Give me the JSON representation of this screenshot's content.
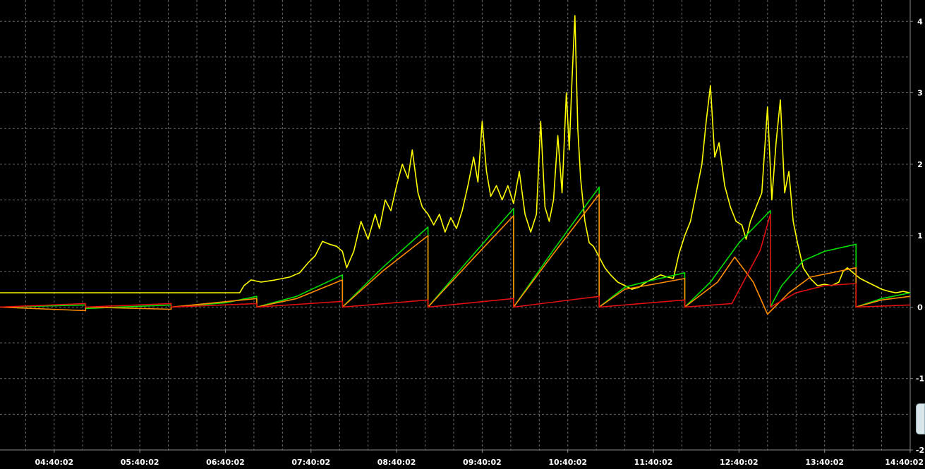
{
  "chart_data": {
    "type": "line",
    "title": "",
    "xlabel": "",
    "ylabel": "",
    "ylim": [
      -2,
      4.2
    ],
    "yticks": [
      "-2",
      "-1",
      "0",
      "1",
      "2",
      "3",
      "4"
    ],
    "xticks": [
      "04:40:02",
      "05:40:02",
      "06:40:02",
      "07:40:02",
      "08:40:02",
      "09:40:02",
      "10:40:02",
      "11:40:02",
      "12:40:02",
      "13:40:02",
      "14:40:02"
    ],
    "xlim": [
      "04:02",
      "14:40"
    ],
    "grid": true,
    "background": "#000000",
    "series": [
      {
        "color": "#ffff00",
        "points": [
          [
            "04:02",
            0.2
          ],
          [
            "05:00",
            0.2
          ],
          [
            "06:00",
            0.2
          ],
          [
            "06:50",
            0.2
          ],
          [
            "06:53",
            0.3
          ],
          [
            "06:58",
            0.38
          ],
          [
            "07:05",
            0.35
          ],
          [
            "07:15",
            0.38
          ],
          [
            "07:25",
            0.42
          ],
          [
            "07:32",
            0.48
          ],
          [
            "07:38",
            0.62
          ],
          [
            "07:43",
            0.72
          ],
          [
            "07:48",
            0.92
          ],
          [
            "07:53",
            0.88
          ],
          [
            "07:58",
            0.85
          ],
          [
            "08:02",
            0.78
          ],
          [
            "08:05",
            0.55
          ],
          [
            "08:10",
            0.78
          ],
          [
            "08:15",
            1.2
          ],
          [
            "08:20",
            0.95
          ],
          [
            "08:25",
            1.3
          ],
          [
            "08:28",
            1.1
          ],
          [
            "08:32",
            1.5
          ],
          [
            "08:36",
            1.35
          ],
          [
            "08:40",
            1.7
          ],
          [
            "08:44",
            2.0
          ],
          [
            "08:48",
            1.8
          ],
          [
            "08:51",
            2.2
          ],
          [
            "08:55",
            1.6
          ],
          [
            "08:58",
            1.4
          ],
          [
            "09:02",
            1.3
          ],
          [
            "09:06",
            1.15
          ],
          [
            "09:10",
            1.3
          ],
          [
            "09:14",
            1.05
          ],
          [
            "09:18",
            1.25
          ],
          [
            "09:22",
            1.1
          ],
          [
            "09:26",
            1.35
          ],
          [
            "09:30",
            1.7
          ],
          [
            "09:34",
            2.1
          ],
          [
            "09:37",
            1.75
          ],
          [
            "09:40",
            2.6
          ],
          [
            "09:43",
            1.9
          ],
          [
            "09:46",
            1.55
          ],
          [
            "09:50",
            1.7
          ],
          [
            "09:54",
            1.5
          ],
          [
            "09:58",
            1.7
          ],
          [
            "10:02",
            1.45
          ],
          [
            "10:06",
            1.9
          ],
          [
            "10:10",
            1.3
          ],
          [
            "10:14",
            1.05
          ],
          [
            "10:18",
            1.3
          ],
          [
            "10:21",
            2.6
          ],
          [
            "10:24",
            1.4
          ],
          [
            "10:27",
            1.2
          ],
          [
            "10:30",
            1.5
          ],
          [
            "10:33",
            2.4
          ],
          [
            "10:36",
            1.6
          ],
          [
            "10:39",
            3.0
          ],
          [
            "10:41",
            2.2
          ],
          [
            "10:43",
            3.2
          ],
          [
            "10:45",
            4.08
          ],
          [
            "10:47",
            2.5
          ],
          [
            "10:49",
            1.8
          ],
          [
            "10:52",
            1.2
          ],
          [
            "10:55",
            0.9
          ],
          [
            "10:58",
            0.85
          ],
          [
            "11:02",
            0.7
          ],
          [
            "11:06",
            0.55
          ],
          [
            "11:10",
            0.45
          ],
          [
            "11:15",
            0.35
          ],
          [
            "11:20",
            0.3
          ],
          [
            "11:25",
            0.25
          ],
          [
            "11:30",
            0.28
          ],
          [
            "11:35",
            0.35
          ],
          [
            "11:40",
            0.4
          ],
          [
            "11:45",
            0.45
          ],
          [
            "11:50",
            0.42
          ],
          [
            "11:54",
            0.4
          ],
          [
            "11:58",
            0.75
          ],
          [
            "12:02",
            1.0
          ],
          [
            "12:06",
            1.2
          ],
          [
            "12:10",
            1.6
          ],
          [
            "12:14",
            2.0
          ],
          [
            "12:17",
            2.6
          ],
          [
            "12:20",
            3.1
          ],
          [
            "12:23",
            2.1
          ],
          [
            "12:26",
            2.3
          ],
          [
            "12:30",
            1.7
          ],
          [
            "12:34",
            1.4
          ],
          [
            "12:38",
            1.2
          ],
          [
            "12:42",
            1.15
          ],
          [
            "12:45",
            0.95
          ],
          [
            "12:48",
            1.2
          ],
          [
            "12:52",
            1.4
          ],
          [
            "12:56",
            1.6
          ],
          [
            "13:00",
            2.8
          ],
          [
            "13:03",
            1.5
          ],
          [
            "13:06",
            2.3
          ],
          [
            "13:09",
            2.9
          ],
          [
            "13:12",
            1.6
          ],
          [
            "13:15",
            1.9
          ],
          [
            "13:18",
            1.2
          ],
          [
            "13:21",
            0.9
          ],
          [
            "13:25",
            0.55
          ],
          [
            "13:30",
            0.4
          ],
          [
            "13:35",
            0.3
          ],
          [
            "13:40",
            0.32
          ],
          [
            "13:45",
            0.3
          ],
          [
            "13:50",
            0.35
          ],
          [
            "13:53",
            0.5
          ],
          [
            "13:56",
            0.55
          ],
          [
            "14:00",
            0.48
          ],
          [
            "14:05",
            0.4
          ],
          [
            "14:10",
            0.35
          ],
          [
            "14:15",
            0.3
          ],
          [
            "14:20",
            0.25
          ],
          [
            "14:25",
            0.22
          ],
          [
            "14:30",
            0.2
          ],
          [
            "14:35",
            0.22
          ],
          [
            "14:40",
            0.2
          ]
        ]
      },
      {
        "color": "#00e000",
        "points": [
          [
            "04:02",
            0.0
          ],
          [
            "05:02",
            0.03
          ],
          [
            "05:02",
            -0.02
          ],
          [
            "06:02",
            0.03
          ],
          [
            "06:02",
            0.0
          ],
          [
            "06:40",
            0.06
          ],
          [
            "07:02",
            0.15
          ],
          [
            "07:02",
            0.0
          ],
          [
            "07:30",
            0.15
          ],
          [
            "08:02",
            0.45
          ],
          [
            "08:02",
            0.0
          ],
          [
            "08:30",
            0.55
          ],
          [
            "09:02",
            1.12
          ],
          [
            "09:02",
            0.0
          ],
          [
            "09:30",
            0.65
          ],
          [
            "10:02",
            1.38
          ],
          [
            "10:02",
            0.0
          ],
          [
            "10:30",
            0.8
          ],
          [
            "11:02",
            1.68
          ],
          [
            "11:02",
            0.0
          ],
          [
            "11:20",
            0.28
          ],
          [
            "11:40",
            0.38
          ],
          [
            "12:02",
            0.48
          ],
          [
            "12:02",
            0.0
          ],
          [
            "12:20",
            0.35
          ],
          [
            "12:40",
            0.9
          ],
          [
            "13:02",
            1.35
          ],
          [
            "13:02",
            0.0
          ],
          [
            "13:10",
            0.3
          ],
          [
            "13:25",
            0.65
          ],
          [
            "13:40",
            0.78
          ],
          [
            "14:02",
            0.88
          ],
          [
            "14:02",
            0.0
          ],
          [
            "14:20",
            0.12
          ],
          [
            "14:40",
            0.2
          ]
        ]
      },
      {
        "color": "#ff8c00",
        "points": [
          [
            "04:02",
            0.0
          ],
          [
            "05:02",
            -0.05
          ],
          [
            "05:02",
            0.0
          ],
          [
            "06:02",
            -0.03
          ],
          [
            "06:02",
            0.0
          ],
          [
            "07:02",
            0.12
          ],
          [
            "07:02",
            0.0
          ],
          [
            "07:30",
            0.12
          ],
          [
            "08:02",
            0.38
          ],
          [
            "08:02",
            0.0
          ],
          [
            "08:30",
            0.5
          ],
          [
            "09:02",
            1.0
          ],
          [
            "09:02",
            0.0
          ],
          [
            "09:30",
            0.6
          ],
          [
            "10:02",
            1.28
          ],
          [
            "10:02",
            0.0
          ],
          [
            "10:30",
            0.75
          ],
          [
            "11:02",
            1.58
          ],
          [
            "11:02",
            0.0
          ],
          [
            "11:20",
            0.25
          ],
          [
            "11:40",
            0.32
          ],
          [
            "12:02",
            0.4
          ],
          [
            "12:02",
            0.0
          ],
          [
            "12:25",
            0.35
          ],
          [
            "12:37",
            0.7
          ],
          [
            "12:50",
            0.35
          ],
          [
            "13:00",
            -0.1
          ],
          [
            "13:15",
            0.2
          ],
          [
            "13:30",
            0.42
          ],
          [
            "14:02",
            0.55
          ],
          [
            "14:02",
            0.0
          ],
          [
            "14:20",
            0.1
          ],
          [
            "14:40",
            0.15
          ]
        ]
      },
      {
        "color": "#e01010",
        "points": [
          [
            "04:02",
            0.0
          ],
          [
            "05:02",
            0.05
          ],
          [
            "05:02",
            0.0
          ],
          [
            "06:02",
            0.05
          ],
          [
            "06:02",
            0.0
          ],
          [
            "07:02",
            0.05
          ],
          [
            "07:02",
            0.0
          ],
          [
            "08:02",
            0.08
          ],
          [
            "08:02",
            0.0
          ],
          [
            "09:02",
            0.1
          ],
          [
            "09:02",
            0.0
          ],
          [
            "10:02",
            0.12
          ],
          [
            "10:02",
            0.0
          ],
          [
            "11:02",
            0.15
          ],
          [
            "11:02",
            0.0
          ],
          [
            "12:02",
            0.1
          ],
          [
            "12:02",
            0.0
          ],
          [
            "12:35",
            0.05
          ],
          [
            "12:55",
            0.8
          ],
          [
            "13:02",
            1.3
          ],
          [
            "13:02",
            0.0
          ],
          [
            "13:20",
            0.2
          ],
          [
            "13:40",
            0.3
          ],
          [
            "14:02",
            0.33
          ],
          [
            "14:02",
            0.0
          ],
          [
            "14:40",
            0.03
          ]
        ]
      }
    ]
  }
}
